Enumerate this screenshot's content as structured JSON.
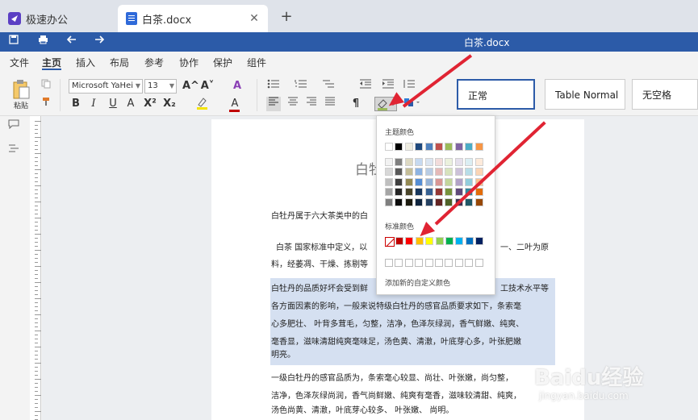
{
  "tabs": [
    {
      "label": "极速办公"
    },
    {
      "label": "白茶.docx"
    }
  ],
  "new_tab": "+",
  "close": "✕",
  "title_bar": {
    "title": "白茶.docx"
  },
  "menu": [
    "文件",
    "主页",
    "插入",
    "布局",
    "参考",
    "协作",
    "保护",
    "组件"
  ],
  "ribbon": {
    "paste_label": "粘贴",
    "font_name": "Microsoft YaHei",
    "font_size": "13",
    "bold": "B",
    "italic": "I",
    "underline": "U",
    "strike": "A",
    "superscript": "X²",
    "subscript": "X₂",
    "grow": "A^",
    "shrink": "A˅",
    "font_color": "A",
    "pilcrow": "¶",
    "styles": [
      "正常",
      "Table Normal",
      "无空格"
    ]
  },
  "palette": {
    "theme_label": "主题颜色",
    "standard_label": "标准颜色",
    "custom_label": "添加新的自定义颜色",
    "theme_top": [
      "#ffffff",
      "#000000",
      "#eeece1",
      "#1f497d",
      "#4f81bd",
      "#c0504d",
      "#9bbb59",
      "#8064a2",
      "#4bacc6",
      "#f79646"
    ],
    "theme_shades": [
      [
        "#f2f2f2",
        "#7f7f7f",
        "#ddd9c3",
        "#c6d9f0",
        "#dbe5f1",
        "#f2dcdb",
        "#ebf1dd",
        "#e5e0ec",
        "#dbeef3",
        "#fdeada"
      ],
      [
        "#d8d8d8",
        "#595959",
        "#c4bd97",
        "#8db3e2",
        "#b8cce4",
        "#e5b9b7",
        "#d7e3bc",
        "#ccc1d9",
        "#b7dde8",
        "#fbd5b5"
      ],
      [
        "#bfbfbf",
        "#3f3f3f",
        "#938953",
        "#548dd4",
        "#95b3d7",
        "#d99694",
        "#c3d69b",
        "#b2a2c7",
        "#92cddc",
        "#fac08f"
      ],
      [
        "#a5a5a5",
        "#262626",
        "#494429",
        "#17365d",
        "#366092",
        "#953734",
        "#76923c",
        "#5f497a",
        "#31859b",
        "#e36c09"
      ],
      [
        "#7f7f7f",
        "#0c0c0c",
        "#1d1b10",
        "#0f243e",
        "#244061",
        "#632423",
        "#4f6128",
        "#3f3151",
        "#205867",
        "#974806"
      ]
    ],
    "standard": [
      "#c00000",
      "#ff0000",
      "#ffc000",
      "#ffff00",
      "#92d050",
      "#00b050",
      "#00b0f0",
      "#0070c0",
      "#002060"
    ]
  },
  "document": {
    "title": "白牡",
    "lines": [
      "白牡丹属于六大茶类中的白",
      "白茶  国家标准中定义，以",
      "料，经萎凋、干燥、拣剔等",
      "白牡丹的品质好坏会受到鲜",
      "各方面因素的影响，一般来说特级白牡丹的感官品质要求如下，条索毫",
      "心多肥壮、 叶背多茸毛，匀整，洁净，色泽灰绿润，香气鲜嫩、纯爽、",
      "毫香显，滋味清甜纯爽毫味足，汤色黄、清澈，叶底芽心多，叶张肥嫩",
      "明亮。",
      "一级白牡丹的感官品质为，条索毫心较显、尚壮、叶张嫩，尚匀整，",
      "洁净，色泽灰绿尚润，香气尚鲜嫩、纯爽有毫香，滋味较清甜、纯爽，",
      "汤色尚黄、清澈，叶底芽心较多、 叶张嫩、 尚明。"
    ],
    "right_frag_1": "一、二叶为原",
    "right_frag_2": "工技术水平等"
  },
  "watermark": {
    "main": "Baidu经验",
    "sub": "jingyan.baidu.com"
  }
}
